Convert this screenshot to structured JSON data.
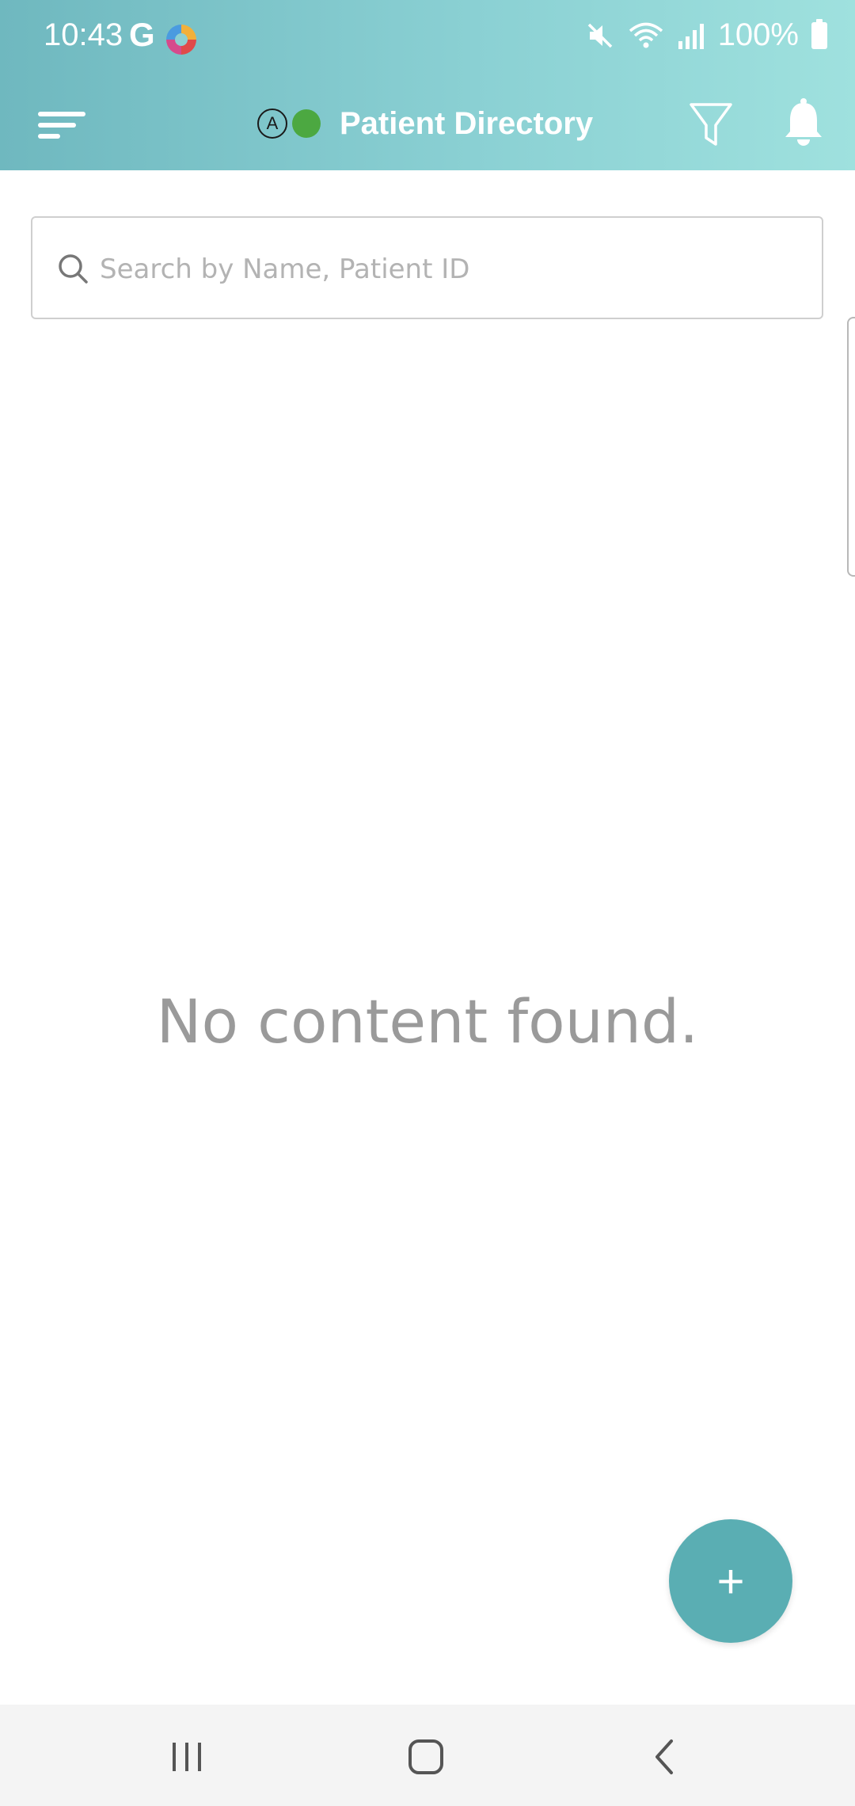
{
  "status_bar": {
    "time": "10:43",
    "g_label": "G",
    "battery": "100%",
    "icons": [
      "google-icon",
      "colorful-app-icon",
      "mute-icon",
      "wifi-icon",
      "signal-icon",
      "battery-icon"
    ]
  },
  "app_bar": {
    "mode_badge": "A",
    "online_status_color": "#4ca841",
    "title": "Patient Directory",
    "icons": [
      "menu-icon",
      "filter-icon",
      "bell-icon"
    ]
  },
  "search": {
    "placeholder": "Search by Name, Patient ID",
    "value": ""
  },
  "main": {
    "empty_message": "No content found."
  },
  "fab": {
    "label": "+"
  },
  "nav_bar": {
    "icons": [
      "recent-apps-icon",
      "home-icon",
      "back-icon"
    ]
  },
  "colors": {
    "header_gradient_start": "#6fb8bf",
    "header_gradient_end": "#9fe1de",
    "fab": "#5aaeb3",
    "empty_text": "#9a9a9a"
  }
}
